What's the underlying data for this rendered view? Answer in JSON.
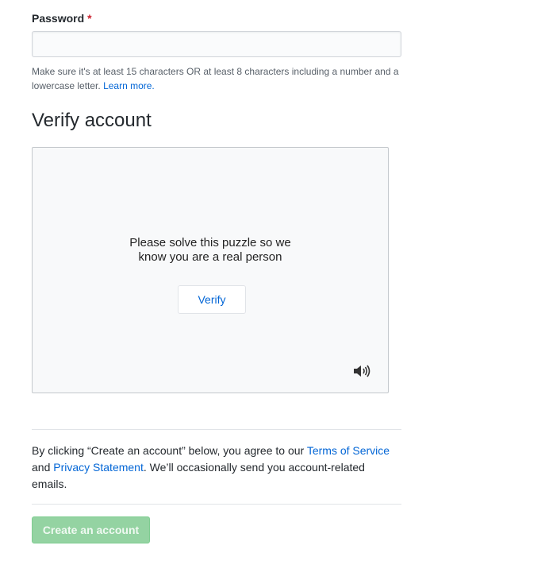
{
  "password_field": {
    "label": "Password",
    "required_marker": "*",
    "value": "",
    "placeholder": "",
    "hint_text": "Make sure it's at least 15 characters OR at least 8 characters including a number and a lowercase letter.",
    "hint_link": "Learn more."
  },
  "verify_section": {
    "title": "Verify account",
    "puzzle_line_1": "Please solve this puzzle so we",
    "puzzle_line_2": "know you are a real person",
    "verify_button": "Verify",
    "audio_icon": "speaker-icon"
  },
  "terms": {
    "prefix": "By clicking “Create an account” below, you agree to our ",
    "terms_link": "Terms of Service",
    "middle": " and ",
    "privacy_link": "Privacy Statement",
    "suffix": ". We’ll occasionally send you account-related emails."
  },
  "create_button": {
    "label": "Create an account"
  },
  "colors": {
    "link": "#0366d6",
    "required": "#cb2431",
    "create_button_bg": "#94d3a2",
    "text": "#24292e"
  }
}
